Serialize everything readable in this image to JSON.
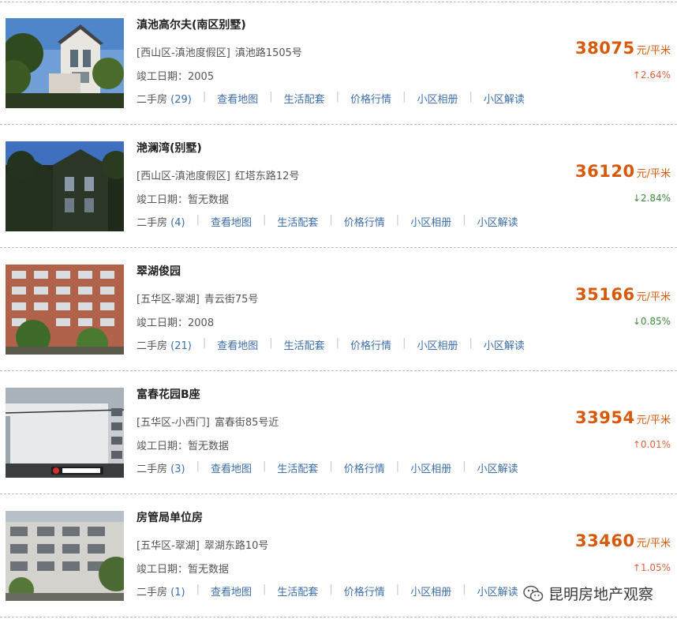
{
  "listings": [
    {
      "name": "滇池高尔夫(南区别墅)",
      "district": "[西山区-滇池度假区]",
      "street": "滇池路1505号",
      "built_label": "竣工日期：",
      "built": "2005",
      "price": "38075",
      "unit": "元/平米",
      "change_arrow": "↑",
      "change": "2.64%",
      "change_dir": "up",
      "second_hand_label": "二手房",
      "second_hand_count": "(29)",
      "links": [
        "查看地图",
        "生活配套",
        "价格行情",
        "小区相册",
        "小区解读"
      ]
    },
    {
      "name": "滟澜湾(别墅)",
      "district": "[西山区-滇池度假区]",
      "street": "红塔东路12号",
      "built_label": "竣工日期：",
      "built": "暂无数据",
      "price": "36120",
      "unit": "元/平米",
      "change_arrow": "↓",
      "change": "2.84%",
      "change_dir": "down",
      "second_hand_label": "二手房",
      "second_hand_count": "(4)",
      "links": [
        "查看地图",
        "生活配套",
        "价格行情",
        "小区相册",
        "小区解读"
      ]
    },
    {
      "name": "翠湖俊园",
      "district": "[五华区-翠湖]",
      "street": "青云街75号",
      "built_label": "竣工日期：",
      "built": "2008",
      "price": "35166",
      "unit": "元/平米",
      "change_arrow": "↓",
      "change": "0.85%",
      "change_dir": "down",
      "second_hand_label": "二手房",
      "second_hand_count": "(21)",
      "links": [
        "查看地图",
        "生活配套",
        "价格行情",
        "小区相册",
        "小区解读"
      ]
    },
    {
      "name": "富春花园B座",
      "district": "[五华区-小西门]",
      "street": "富春街85号近",
      "built_label": "竣工日期：",
      "built": "暂无数据",
      "price": "33954",
      "unit": "元/平米",
      "change_arrow": "↑",
      "change": "0.01%",
      "change_dir": "up",
      "second_hand_label": "二手房",
      "second_hand_count": "(3)",
      "links": [
        "查看地图",
        "生活配套",
        "价格行情",
        "小区相册",
        "小区解读"
      ]
    },
    {
      "name": "房管局单位房",
      "district": "[五华区-翠湖]",
      "street": "翠湖东路10号",
      "built_label": "竣工日期：",
      "built": "暂无数据",
      "price": "33460",
      "unit": "元/平米",
      "change_arrow": "↑",
      "change": "1.05%",
      "change_dir": "up",
      "second_hand_label": "二手房",
      "second_hand_count": "(1)",
      "links": [
        "查看地图",
        "生活配套",
        "价格行情",
        "小区相册",
        "小区解读"
      ]
    }
  ],
  "watermark": {
    "icon": "wechat-icon",
    "text": "昆明房地产观察"
  },
  "colors": {
    "price": "#d9590b",
    "link": "#3c6ea7",
    "up": "#e0633a",
    "down": "#3e8a3e"
  },
  "thumb_scenes": [
    "villa-sky",
    "villa-trees",
    "apartment-red",
    "tower-white",
    "apartment-grey"
  ]
}
